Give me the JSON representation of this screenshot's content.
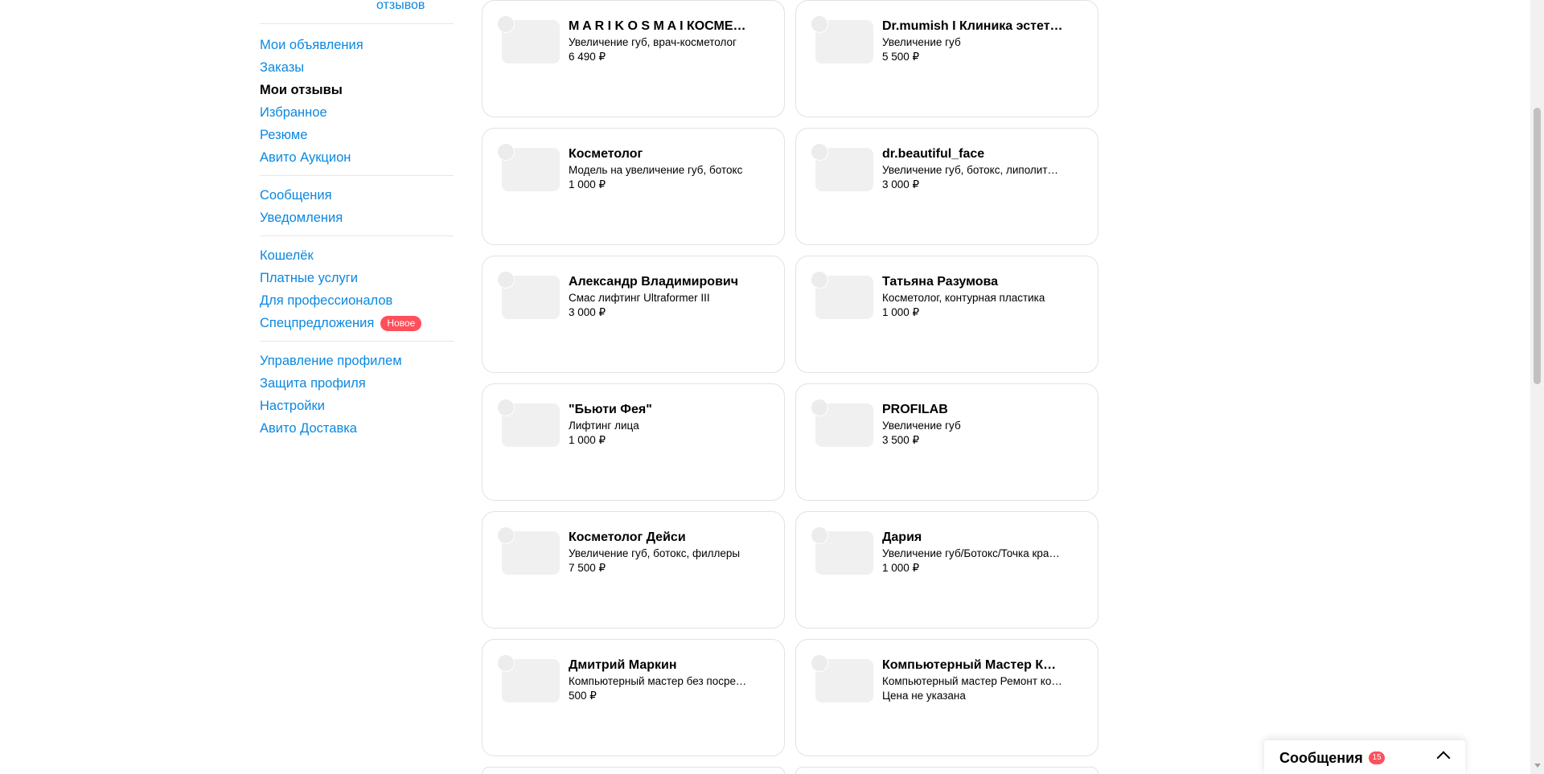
{
  "sidebar": {
    "reviews_link": "отзывов",
    "group1": [
      {
        "label": "Мои объявления",
        "active": false
      },
      {
        "label": "Заказы",
        "active": false
      },
      {
        "label": "Мои отзывы",
        "active": true
      },
      {
        "label": "Избранное",
        "active": false
      },
      {
        "label": "Резюме",
        "active": false
      },
      {
        "label": "Авито Аукцион",
        "active": false
      }
    ],
    "group2": [
      {
        "label": "Сообщения"
      },
      {
        "label": "Уведомления"
      }
    ],
    "group3": [
      {
        "label": "Кошелёк"
      },
      {
        "label": "Платные услуги"
      },
      {
        "label": "Для профессионалов"
      },
      {
        "label": "Спецпредложения",
        "badge": "Новое"
      }
    ],
    "group4": [
      {
        "label": "Управление профилем"
      },
      {
        "label": "Защита профиля"
      },
      {
        "label": "Настройки"
      },
      {
        "label": "Авито Доставка"
      }
    ]
  },
  "cards": [
    {
      "title": "M A R I K O S M A I КОСМЕТОЛОГ",
      "subtitle": "Увеличение губ, врач-косметолог",
      "price": "6 490 ₽"
    },
    {
      "title": "Dr.mumish I Клиника эстетики",
      "subtitle": "Увеличение губ",
      "price": "5 500 ₽"
    },
    {
      "title": "Косметолог",
      "subtitle": "Модель на увеличение губ, ботокс",
      "price": "1 000 ₽"
    },
    {
      "title": "dr.beautiful_face",
      "subtitle": "Увеличение губ, ботокс, липолитики",
      "price": "3 000 ₽"
    },
    {
      "title": "Александр Владимирович",
      "subtitle": "Смас лифтинг Ultraformer III",
      "price": "3 000 ₽"
    },
    {
      "title": "Татьяна Разумова",
      "subtitle": "Косметолог, контурная пластика",
      "price": "1 000 ₽"
    },
    {
      "title": "\"Бьюти Фея\"",
      "subtitle": "Лифтинг лица",
      "price": "1 000 ₽"
    },
    {
      "title": "PROFILAB",
      "subtitle": "Увеличение губ",
      "price": "3 500 ₽"
    },
    {
      "title": "Косметолог Дейси",
      "subtitle": "Увеличение губ, ботокс, филлеры",
      "price": "7 500 ₽"
    },
    {
      "title": "Дария",
      "subtitle": "Увеличение губ/Ботокс/Точка красоты",
      "price": "1 000 ₽"
    },
    {
      "title": "Дмитрий Маркин",
      "subtitle": "Компьютерный мастер без посредников",
      "price": "500 ₽"
    },
    {
      "title": "Компьютерный Мастер Красноярск",
      "subtitle": "Компьютерный мастер Ремонт компьютеров",
      "price": "Цена не указана"
    }
  ],
  "messages_bar": {
    "label": "Сообщения",
    "count": "15"
  },
  "colors": {
    "link": "#0a88e0",
    "badge": "#ff4f5a",
    "card_border": "#e2e2e2",
    "thumb_bg": "#f0f0f0"
  }
}
